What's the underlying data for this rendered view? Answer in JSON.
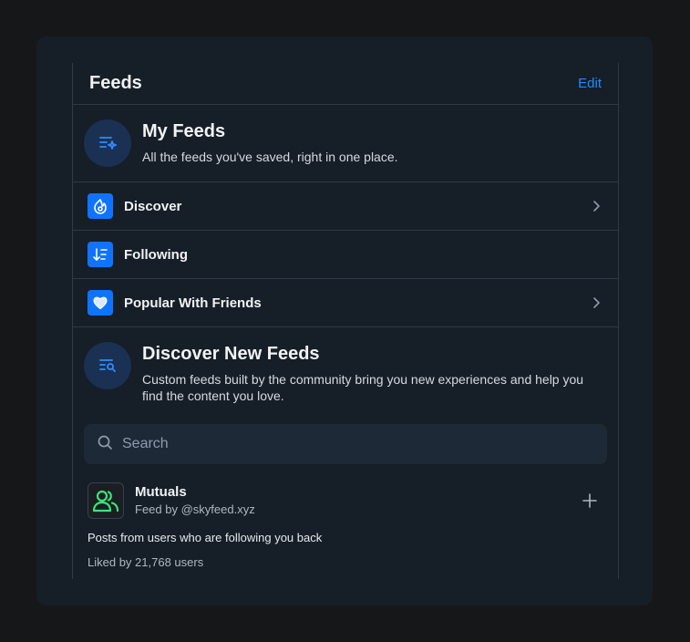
{
  "header": {
    "title": "Feeds",
    "edit_label": "Edit"
  },
  "my_feeds": {
    "title": "My Feeds",
    "description": "All the feeds you've saved, right in one place.",
    "icon": "feeds-list-sparkle-icon"
  },
  "saved_feeds": [
    {
      "label": "Discover",
      "icon": "discover-icon",
      "has_chevron": true
    },
    {
      "label": "Following",
      "icon": "sort-down-icon",
      "has_chevron": false
    },
    {
      "label": "Popular With Friends",
      "icon": "heart-icon",
      "has_chevron": true
    }
  ],
  "discover": {
    "title": "Discover New Feeds",
    "description": "Custom feeds built by the community bring you new experiences and help you find the content you love.",
    "icon": "feeds-search-icon"
  },
  "search": {
    "placeholder": "Search",
    "value": ""
  },
  "feed_card": {
    "name": "Mutuals",
    "by": "Feed by @skyfeed.xyz",
    "description": "Posts from users who are following you back",
    "likes": "Liked by 21,768 users",
    "icon": "people-icon"
  },
  "colors": {
    "accent": "#208bfe",
    "icon_bg": "#0f73ff",
    "panel_bg": "#161e27",
    "page_bg": "#161718",
    "people_icon": "#3de378"
  }
}
